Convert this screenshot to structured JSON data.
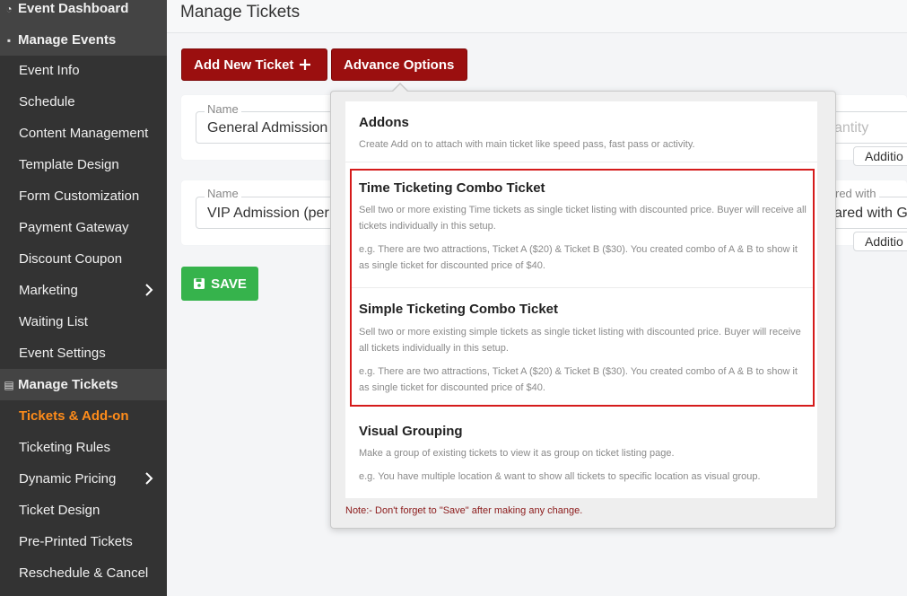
{
  "sidebar": {
    "items": [
      {
        "label": "Event Dashboard",
        "kind": "group",
        "icon": "dashboard-icon"
      },
      {
        "label": "Manage Events",
        "kind": "group",
        "icon": "calendar-icon"
      },
      {
        "label": "Event Info",
        "kind": "sub"
      },
      {
        "label": "Schedule",
        "kind": "sub"
      },
      {
        "label": "Content Management",
        "kind": "sub"
      },
      {
        "label": "Template Design",
        "kind": "sub"
      },
      {
        "label": "Form Customization",
        "kind": "sub"
      },
      {
        "label": "Payment Gateway",
        "kind": "sub"
      },
      {
        "label": "Discount Coupon",
        "kind": "sub"
      },
      {
        "label": "Marketing",
        "kind": "sub",
        "chevron": true
      },
      {
        "label": "Waiting List",
        "kind": "sub"
      },
      {
        "label": "Event Settings",
        "kind": "sub"
      },
      {
        "label": "Manage Tickets",
        "kind": "group",
        "icon": "ticket-icon"
      },
      {
        "label": "Tickets & Add-on",
        "kind": "sub",
        "active": true
      },
      {
        "label": "Ticketing Rules",
        "kind": "sub"
      },
      {
        "label": "Dynamic Pricing",
        "kind": "sub",
        "chevron": true
      },
      {
        "label": "Ticket Design",
        "kind": "sub"
      },
      {
        "label": "Pre-Printed Tickets",
        "kind": "sub"
      },
      {
        "label": "Reschedule & Cancel",
        "kind": "sub"
      }
    ]
  },
  "header": {
    "title": "Manage Tickets"
  },
  "toolbar": {
    "add_ticket_label": "Add New Ticket",
    "advance_options_label": "Advance Options",
    "save_label": "SAVE"
  },
  "tickets": [
    {
      "name_label": "Name",
      "name_value": "General Admission",
      "right_label": "",
      "right_value": "antity",
      "additional_label": "Additio"
    },
    {
      "name_label": "Name",
      "name_value": "VIP Admission (per",
      "right_label": "red with",
      "right_value": "ared with Ge",
      "additional_label": "Additio"
    }
  ],
  "popup": {
    "options": [
      {
        "title": "Addons",
        "desc": "Create Add on to attach with main ticket like speed pass, fast pass or activity."
      },
      {
        "title": "Time Ticketing Combo Ticket",
        "desc": "Sell two or more existing Time tickets as single ticket listing with discounted price. Buyer will receive all tickets individually in this setup.",
        "example": "e.g. There are two attractions, Ticket A ($20) & Ticket B ($30). You created combo of A & B to show it as single ticket for discounted price of $40."
      },
      {
        "title": "Simple Ticketing Combo Ticket",
        "desc": "Sell two or more existing simple tickets as single ticket listing with discounted price. Buyer will receive all tickets individually in this setup.",
        "example": "e.g. There are two attractions, Ticket A ($20) & Ticket B ($30). You created combo of A & B to show it as single ticket for discounted price of $40."
      },
      {
        "title": "Visual Grouping",
        "desc": "Make a group of existing tickets to view it as group on ticket listing page.",
        "example": "e.g. You have multiple location & want to show all tickets to specific location as visual group."
      }
    ],
    "note": "Note:- Don't forget to \"Save\" after making any change."
  },
  "colors": {
    "sidebar_bg": "#333333",
    "sidebar_active": "#ff8c1a",
    "primary_red": "#9b0f0f",
    "save_green": "#36b34c",
    "highlight_red": "#d51b1b"
  }
}
